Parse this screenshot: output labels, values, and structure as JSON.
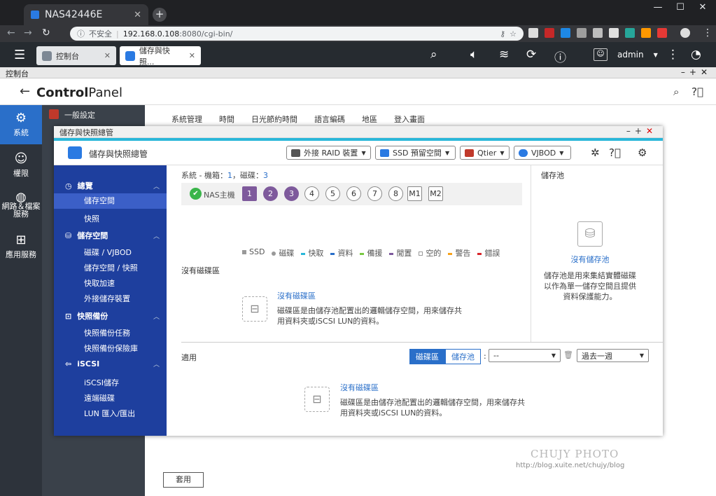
{
  "browser": {
    "tab_title": "NAS42446E",
    "insecure_label": "不安全",
    "url_host": "192.168.0.108",
    "url_path": ":8080/cgi-bin/"
  },
  "qnap_bar": {
    "tabs": [
      {
        "label": "控制台"
      },
      {
        "label": "儲存與快照..."
      }
    ],
    "user": "admin"
  },
  "control_panel": {
    "window_title": "控制台",
    "title_a": "Control",
    "title_b": "Panel",
    "left_nav": [
      {
        "label": "系統"
      },
      {
        "label": "權限"
      },
      {
        "label": "網路＆檔案服務"
      },
      {
        "label": "應用服務"
      }
    ],
    "sub_first": "一般設定",
    "tabs": [
      "系統管理",
      "時間",
      "日光節約時間",
      "語言編碼",
      "地區",
      "登入畫面"
    ],
    "apply_label": "套用"
  },
  "storage_window": {
    "window_title": "儲存與快照總管",
    "app_title": "儲存與快照總管",
    "header_buttons": [
      {
        "label": "外接 RAID 裝置"
      },
      {
        "label": "SSD 預留空間"
      },
      {
        "label": "Qtier"
      },
      {
        "label": "VJBOD"
      }
    ],
    "sidebar": [
      {
        "group": "總覽",
        "items": [
          "儲存空間",
          "快照"
        ]
      },
      {
        "group": "儲存空間",
        "items": [
          "磁碟 / VJBOD",
          "儲存空間 / 快照",
          "快取加速",
          "外接儲存裝置"
        ]
      },
      {
        "group": "快照備份",
        "items": [
          "快照備份任務",
          "快照備份保險庫"
        ]
      },
      {
        "group": "iSCSI",
        "items": [
          "iSCSI儲存",
          "遠端磁碟",
          "LUN 匯入/匯出"
        ]
      }
    ],
    "summary_prefix": "系統 - 機箱：",
    "chassis_count": "1",
    "summary_mid": "，磁碟：",
    "disk_count": "3",
    "nas_label": "NAS主機",
    "bays": [
      "1",
      "2",
      "3",
      "4",
      "5",
      "6",
      "7",
      "8",
      "M1",
      "M2"
    ],
    "legend": [
      {
        "label": "SSD",
        "color": "#999999"
      },
      {
        "label": "磁碟",
        "color": "#999999"
      },
      {
        "label": "快取",
        "color": "#2ab7d9"
      },
      {
        "label": "資料",
        "color": "#2a6fc9"
      },
      {
        "label": "備援",
        "color": "#7ac943"
      },
      {
        "label": "閒置",
        "color": "#7e5a9c"
      },
      {
        "label": "空的",
        "color": "#ffffff"
      },
      {
        "label": "警告",
        "color": "#f7a21b"
      },
      {
        "label": "錯誤",
        "color": "#d9262b"
      }
    ],
    "pool_title": "儲存池",
    "pool_empty_link": "沒有儲存池",
    "pool_desc": "儲存池是用來集結實體磁碟以作為單一儲存空間且提供資料保護能力。",
    "no_volume_label": "沒有磁碟區",
    "empty_volume_link": "沒有磁碟區",
    "empty_volume_desc": "磁碟區是由儲存池配置出的邏輯儲存空間，用來儲存共用資料夾或iSCSI LUN的資料。",
    "util_label": "適用",
    "seg_options": [
      "磁碟區",
      "儲存池"
    ],
    "volume_select": "--",
    "period_select": "過去一週",
    "empty_util_link": "沒有磁碟區",
    "empty_util_desc": "磁碟區是由儲存池配置出的邏輯儲存空間，用來儲存共用資料夾或iSCSI LUN的資料。"
  },
  "watermark": {
    "line1": "CHUJY PHOTO",
    "line2": "http://blog.xuite.net/chujy/blog"
  }
}
